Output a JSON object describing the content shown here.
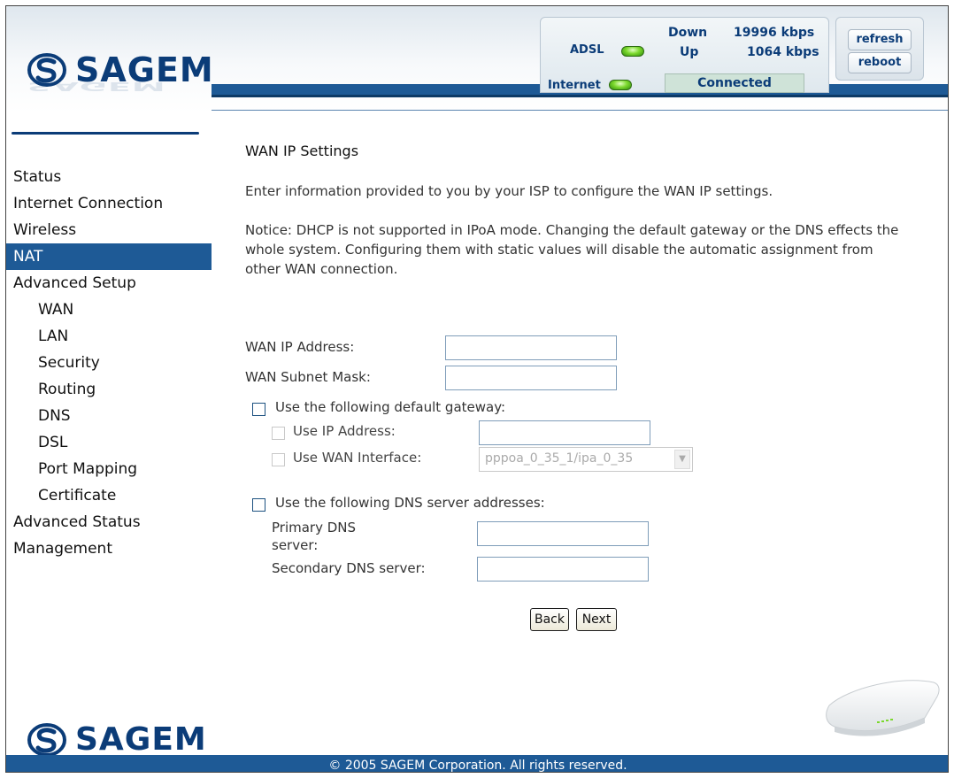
{
  "brand": {
    "name": "SAGEM",
    "colors": {
      "primary": "#1e5a96",
      "dark": "#0b3c78",
      "led": "#7cd92e"
    }
  },
  "status": {
    "adsl_label": "ADSL",
    "internet_label": "Internet",
    "down_label": "Down",
    "down_value": "19996 kbps",
    "up_label": "Up",
    "up_value": "1064 kbps",
    "connection": "Connected",
    "refresh_label": "refresh",
    "reboot_label": "reboot"
  },
  "sidebar": {
    "items": [
      {
        "label": "Status",
        "sub": false
      },
      {
        "label": "Internet Connection",
        "sub": false
      },
      {
        "label": "Wireless",
        "sub": false
      },
      {
        "label": "NAT",
        "sub": false,
        "active": true
      },
      {
        "label": "Advanced Setup",
        "sub": false
      },
      {
        "label": "WAN",
        "sub": true
      },
      {
        "label": "LAN",
        "sub": true
      },
      {
        "label": "Security",
        "sub": true
      },
      {
        "label": "Routing",
        "sub": true
      },
      {
        "label": "DNS",
        "sub": true
      },
      {
        "label": "DSL",
        "sub": true
      },
      {
        "label": "Port Mapping",
        "sub": true
      },
      {
        "label": "Certificate",
        "sub": true
      },
      {
        "label": "Advanced Status",
        "sub": false
      },
      {
        "label": "Management",
        "sub": false
      }
    ]
  },
  "main": {
    "title": "WAN IP Settings",
    "intro": "Enter information provided to you by your ISP to configure the WAN IP settings.",
    "notice": "Notice: DHCP is not supported in IPoA mode. Changing the default gateway or the DNS effects the whole system. Configuring them with static values will disable the automatic assignment from other WAN connection.",
    "wan_ip_label": "WAN IP Address:",
    "wan_ip_value": "",
    "wan_mask_label": "WAN Subnet Mask:",
    "wan_mask_value": "",
    "gateway": {
      "label": "Use the following default gateway:",
      "use_ip_label": "Use IP Address:",
      "use_ip_value": "",
      "use_wan_label": "Use WAN Interface:",
      "wan_interface_selected": "pppoa_0_35_1/ipa_0_35"
    },
    "dns": {
      "label": "Use the following DNS server addresses:",
      "primary_label_line1": "Primary DNS",
      "primary_label_line2": "server:",
      "primary_value": "",
      "secondary_label": "Secondary DNS server:",
      "secondary_value": ""
    },
    "back_label": "Back",
    "next_label": "Next"
  },
  "footer": {
    "copyright": "© 2005 SAGEM Corporation. All rights reserved."
  }
}
